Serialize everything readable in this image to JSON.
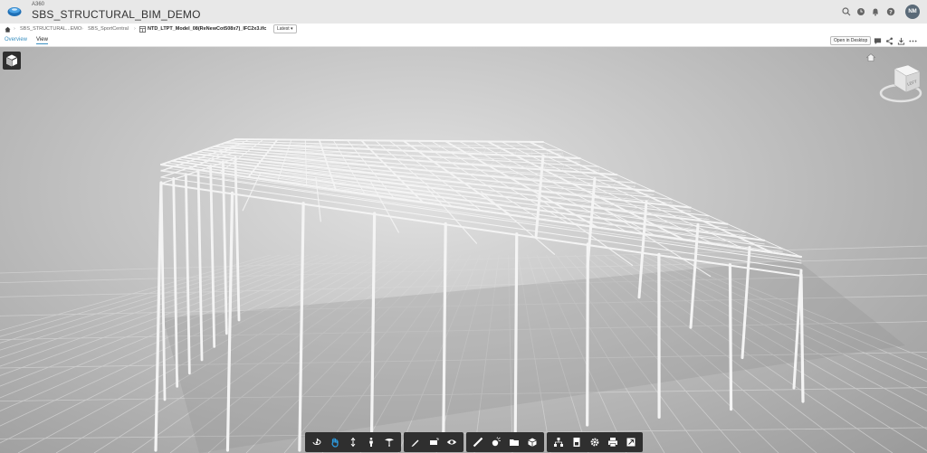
{
  "header": {
    "app_name": "A360",
    "project_title": "SBS_STRUCTURAL_BIM_DEMO",
    "user_initials": "NM"
  },
  "breadcrumb": {
    "items": [
      "SBS_STRUCTURAL...EMO",
      "SBS_SportCentral",
      "NTD_LTPT_Model_08(ReNewCot508x7)_IFC2x3.ifc"
    ],
    "version": "Latest"
  },
  "tabs": {
    "overview": "Overview",
    "view": "View",
    "active": "View"
  },
  "actions": {
    "open_in_desktop": "Open in Desktop"
  },
  "viewcube": {
    "face": "LEFT"
  },
  "toolbar": {
    "groups": [
      [
        "orbit-icon",
        "pan-icon",
        "zoom-icon",
        "first-person-icon",
        "camera-icon"
      ],
      [
        "markup-icon",
        "section-icon",
        "visibility-icon"
      ],
      [
        "measure-icon",
        "explode-icon",
        "folder-icon",
        "model-structure-icon"
      ],
      [
        "properties-icon",
        "settings-icon",
        "print-icon",
        "fullscreen-icon"
      ]
    ],
    "active_tool": "pan-icon"
  },
  "colors": {
    "accent": "#3a8fc1",
    "header_bg": "#e8e8e8",
    "toolbar_bg": "#2f2f2f",
    "avatar_bg": "#5a6a78"
  }
}
